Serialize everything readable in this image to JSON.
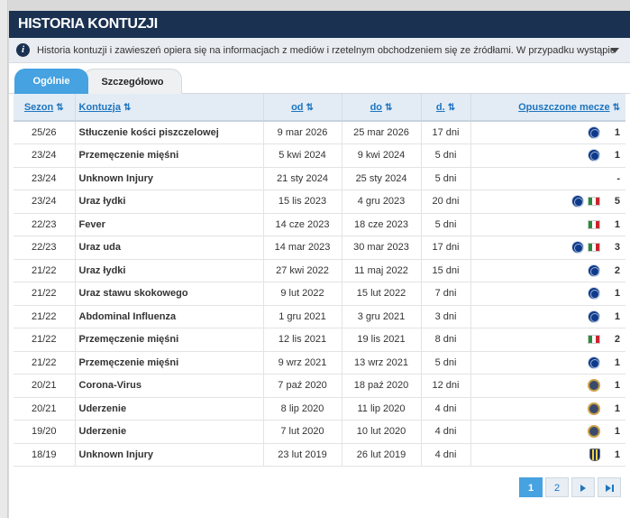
{
  "header": {
    "title": "HISTORIA KONTUZJI"
  },
  "notice": {
    "text": "Historia kontuzji i zawieszeń opiera się na informacjach z mediów i rzetelnym obchodzeniem się ze źródłami. W przypadku wystąpienia błędów..."
  },
  "tabs": [
    {
      "label": "Ogólnie",
      "active": true
    },
    {
      "label": "Szczegółowo",
      "active": false
    }
  ],
  "table": {
    "headers": {
      "season": "Sezon",
      "injury": "Kontuzja",
      "from": "od",
      "until": "do",
      "days": "d.",
      "missed": "Opuszczone mecze"
    },
    "sort_icon": "⇅",
    "rows": [
      {
        "season": "25/26",
        "injury": "Stłuczenie kości piszczelowej",
        "from": "9 mar 2026",
        "until": "25 mar 2026",
        "days": "17 dni",
        "badges": [
          "inter"
        ],
        "games": "1"
      },
      {
        "season": "23/24",
        "injury": "Przemęczenie mięśni",
        "from": "5 kwi 2024",
        "until": "9 kwi 2024",
        "days": "5 dni",
        "badges": [
          "inter"
        ],
        "games": "1"
      },
      {
        "season": "23/24",
        "injury": "Unknown Injury",
        "from": "21 sty 2024",
        "until": "25 sty 2024",
        "days": "5 dni",
        "badges": [],
        "games": "-"
      },
      {
        "season": "23/24",
        "injury": "Uraz łydki",
        "from": "15 lis 2023",
        "until": "4 gru 2023",
        "days": "20 dni",
        "badges": [
          "inter",
          "italy"
        ],
        "games": "5"
      },
      {
        "season": "22/23",
        "injury": "Fever",
        "from": "14 cze 2023",
        "until": "18 cze 2023",
        "days": "5 dni",
        "badges": [
          "italy"
        ],
        "games": "1"
      },
      {
        "season": "22/23",
        "injury": "Uraz uda",
        "from": "14 mar 2023",
        "until": "30 mar 2023",
        "days": "17 dni",
        "badges": [
          "inter",
          "italy"
        ],
        "games": "3"
      },
      {
        "season": "21/22",
        "injury": "Uraz łydki",
        "from": "27 kwi 2022",
        "until": "11 maj 2022",
        "days": "15 dni",
        "badges": [
          "inter"
        ],
        "games": "2"
      },
      {
        "season": "21/22",
        "injury": "Uraz stawu skokowego",
        "from": "9 lut 2022",
        "until": "15 lut 2022",
        "days": "7 dni",
        "badges": [
          "inter"
        ],
        "games": "1"
      },
      {
        "season": "21/22",
        "injury": "Abdominal Influenza",
        "from": "1 gru 2021",
        "until": "3 gru 2021",
        "days": "3 dni",
        "badges": [
          "inter"
        ],
        "games": "1"
      },
      {
        "season": "21/22",
        "injury": "Przemęczenie mięśni",
        "from": "12 lis 2021",
        "until": "19 lis 2021",
        "days": "8 dni",
        "badges": [
          "italy"
        ],
        "games": "2"
      },
      {
        "season": "21/22",
        "injury": "Przemęczenie mięśni",
        "from": "9 wrz 2021",
        "until": "13 wrz 2021",
        "days": "5 dni",
        "badges": [
          "inter"
        ],
        "games": "1"
      },
      {
        "season": "20/21",
        "injury": "Corona-Virus",
        "from": "7 paź 2020",
        "until": "18 paź 2020",
        "days": "12 dni",
        "badges": [
          "inter-old"
        ],
        "games": "1"
      },
      {
        "season": "20/21",
        "injury": "Uderzenie",
        "from": "8 lip 2020",
        "until": "11 lip 2020",
        "days": "4 dni",
        "badges": [
          "inter-old"
        ],
        "games": "1"
      },
      {
        "season": "19/20",
        "injury": "Uderzenie",
        "from": "7 lut 2020",
        "until": "10 lut 2020",
        "days": "4 dni",
        "badges": [
          "inter-old"
        ],
        "games": "1"
      },
      {
        "season": "18/19",
        "injury": "Unknown Injury",
        "from": "23 lut 2019",
        "until": "26 lut 2019",
        "days": "4 dni",
        "badges": [
          "parma"
        ],
        "games": "1"
      }
    ]
  },
  "pagination": {
    "pages": [
      "1",
      "2"
    ],
    "active": "1",
    "next_icon": "arrow-right-icon",
    "last_icon": "arrow-last-icon"
  }
}
